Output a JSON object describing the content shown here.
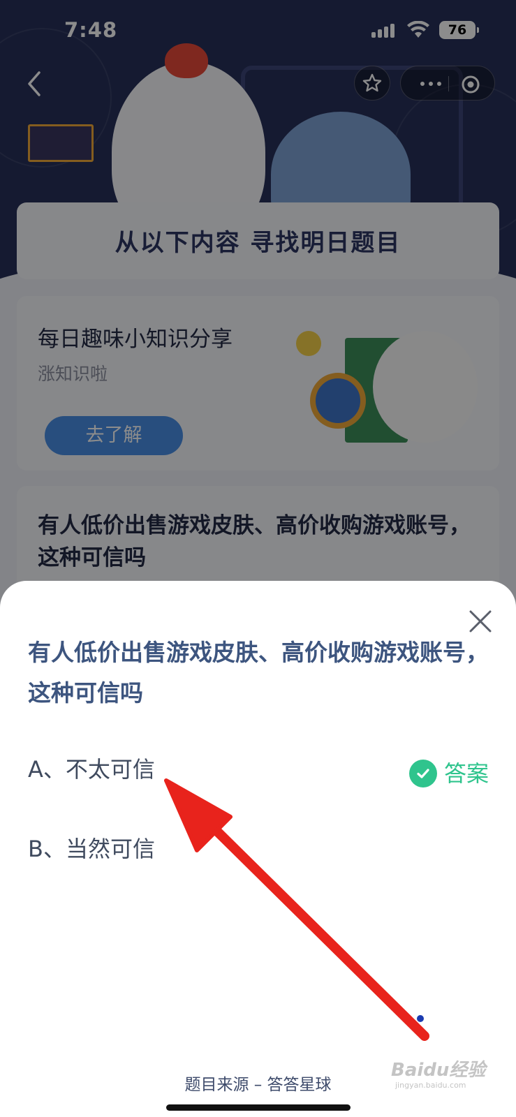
{
  "status_bar": {
    "time": "7:48",
    "battery": "76"
  },
  "nav": {
    "back_icon": "chevron-left-icon",
    "favorite_icon": "star-icon",
    "more_icon": "more-dots-icon",
    "close_app_icon": "target-icon"
  },
  "background_page": {
    "banner_title": "从以下内容 寻找明日题目",
    "share_card": {
      "title": "每日趣味小知识分享",
      "subtitle": "涨知识啦",
      "button": "去了解"
    },
    "question_card": {
      "text": "有人低价出售游戏皮肤、高价收购游戏账号，这种可信吗"
    }
  },
  "sheet": {
    "close_icon": "close-icon",
    "question": "有人低价出售游戏皮肤、高价收购游戏账号，这种可信吗",
    "options": [
      {
        "label": "A、不太可信",
        "is_answer": true
      },
      {
        "label": "B、当然可信",
        "is_answer": false
      }
    ],
    "answer_tag": "答案",
    "source": "题目来源 – 答答星球"
  },
  "watermark": {
    "brand": "Baidu经验",
    "url": "jingyan.baidu.com"
  },
  "colors": {
    "question_text": "#3d557f",
    "answer_green": "#2fc48d",
    "arrow_red": "#e8231c",
    "hero_bg": "#27305a"
  }
}
